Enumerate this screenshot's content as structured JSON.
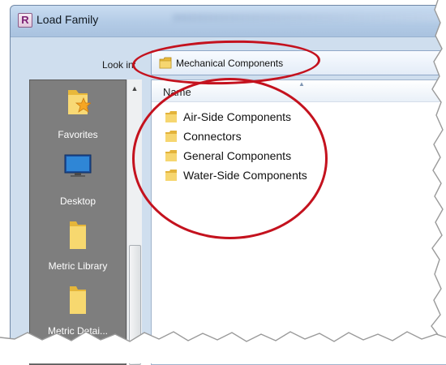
{
  "window": {
    "title": "Load Family",
    "app_icon_letter": "R"
  },
  "lookin": {
    "label": "Look in:",
    "value": "Mechanical Components"
  },
  "places": [
    {
      "label": "Favorites",
      "icon": "favorites-folder-icon"
    },
    {
      "label": "Desktop",
      "icon": "desktop-icon"
    },
    {
      "label": "Metric Library",
      "icon": "folder-icon"
    },
    {
      "label": "Metric Detai...",
      "icon": "folder-icon"
    }
  ],
  "filelist": {
    "column_name": "Name",
    "items": [
      "Air-Side Components",
      "Connectors",
      "General Components",
      "Water-Side Components"
    ]
  },
  "colors": {
    "annotation": "#c4121e",
    "places_bg": "#7e7e7e",
    "folder": "#f2c94c"
  }
}
